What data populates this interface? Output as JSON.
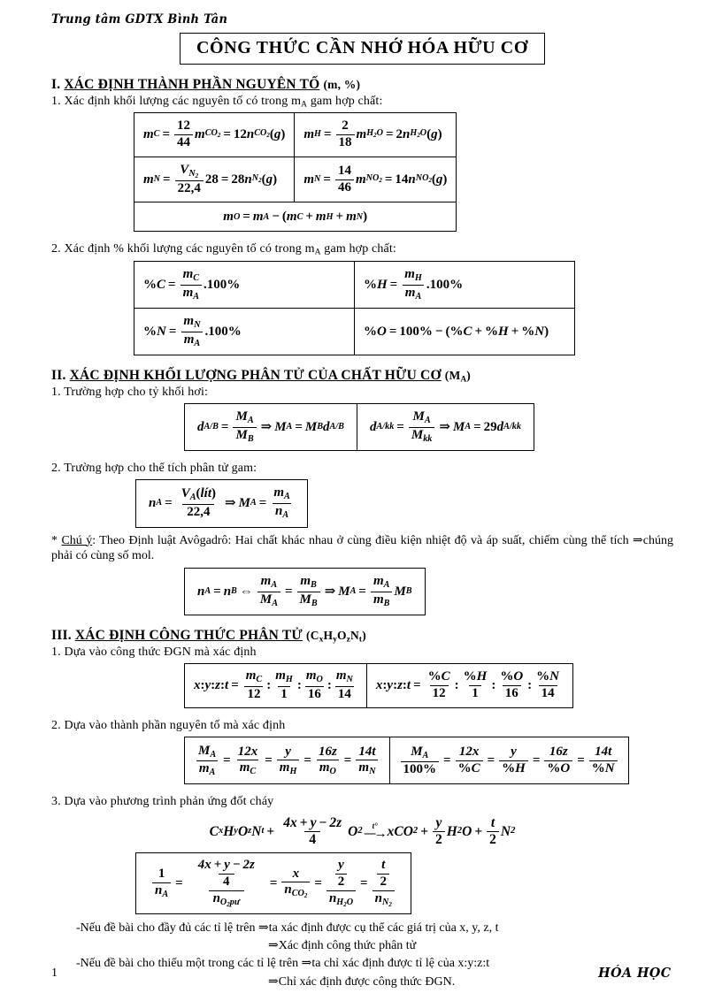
{
  "document": {
    "school_header": "Trung tâm GDTX Bình Tân",
    "title": "CÔNG THỨC CẦN NHỚ HÓA HỮU CƠ",
    "page_number": "1",
    "footer_right": "HÓA HỌC"
  },
  "section1": {
    "number": "I.",
    "heading": "XÁC ĐỊNH THÀNH PHẦN NGUYÊN TỐ",
    "heading_tail": "(m, %)",
    "sub1": "1. Xác định khối lượng các nguyên tố có trong mA gam hợp chất:",
    "sub2": "2. Xác định % khối lượng các nguyên tố có trong mA gam hợp chất:",
    "mass_table": {
      "r1c1": "mC = 12/44 · mCO2 = 12 nCO2 (g)",
      "r1c2": "mH = 2/18 · mH2O = 2 nH2O (g)",
      "r2c1": "mN = VN2/22,4 · 28 = 28 nN2 (g)",
      "r2c2": "mN = 14/46 · mNO2 = 14 nNO2 (g)",
      "r3": "mO = mA − (mC + mH + mN)"
    },
    "percent_table": {
      "r1c1": "%C = mC/mA · 100%",
      "r1c2": "%H = mH/mA · 100%",
      "r2c1": "%N = mN/mA · 100%",
      "r2c2": "%O = 100% − (%C + %H + %N)"
    }
  },
  "section2": {
    "number": "II.",
    "heading": "XÁC ĐỊNH KHỐI LƯỢNG PHÂN TỬ CỦA CHẤT HỮU CƠ",
    "heading_tail": "(MA)",
    "sub1": "1. Trường hợp cho tỷ khối hơi:",
    "sub2": "2. Trường hợp cho thể tích phân tử gam:",
    "density_table": {
      "c1": "dA/B = MA/MB ⇒ MA = MB · dA/B",
      "c2": "dA/kk = MA/Mkk ⇒ MA = 29 dA/kk"
    },
    "volume_box": "nA = VA(lít)/22,4 ⇒ MA = mA/nA",
    "note_label": "Chú ý",
    "note_text": ": Theo Định luật Avôgadrô: Hai chất khác nhau ở cùng điều kiện nhiệt độ và áp suất, chiếm cùng thể tích ⇒ chúng phải có cùng số mol.",
    "avogadro_box": "nA = nB ⇔ mA/MA = mB/MB ⇒ MA = mA/mB · MB"
  },
  "section3": {
    "number": "III.",
    "heading": "XÁC ĐỊNH CÔNG THỨC PHÂN TỬ",
    "heading_tail": "(CxHyOzNt)",
    "sub1": "1. Dựa vào công thức ĐGN mà xác định",
    "sub2": "2. Dựa vào thành phần nguyên tố mà xác định",
    "sub3": "3. Dựa vào phương trình phản ứng đốt cháy",
    "ratio_table": {
      "c1": "x : y : z : t = mC/12 : mH/1 : mO/16 : mN/14",
      "c2": "x : y : z : t = %C/12 : %H/1 : %O/16 : %N/14"
    },
    "composition_table": {
      "c1": "MA/mA = 12x/mC = y/mH = 16z/mO = 14t/mN",
      "c2": "MA/100% = 12x/%C = y/%H = 16z/%O = 14t/%N"
    },
    "combustion_equation": "CxHyOzNt + (4x + y − 2z)/4 O2 --t°--> xCO2 + y/2 H2O + t/2 N2",
    "combustion_ratio_box": "1/nA = ((4x+y−2z)/4)/nO2 pư = x/nCO2 = (y/2)/nH2O = (t/2)/nN2",
    "conclusions": [
      "-Nếu đề bài cho đầy đủ các tỉ lệ trên ⇒ta xác định được cụ thể các giá trị của x, y, z, t",
      "⇒Xác định công thức phân tử",
      "-Nếu đề bài cho thiếu một trong các tỉ lệ trên ⇒ta chỉ xác định được tỉ lệ của x:y:z:t",
      "⇒Chỉ xác định được công thức ĐGN."
    ]
  }
}
